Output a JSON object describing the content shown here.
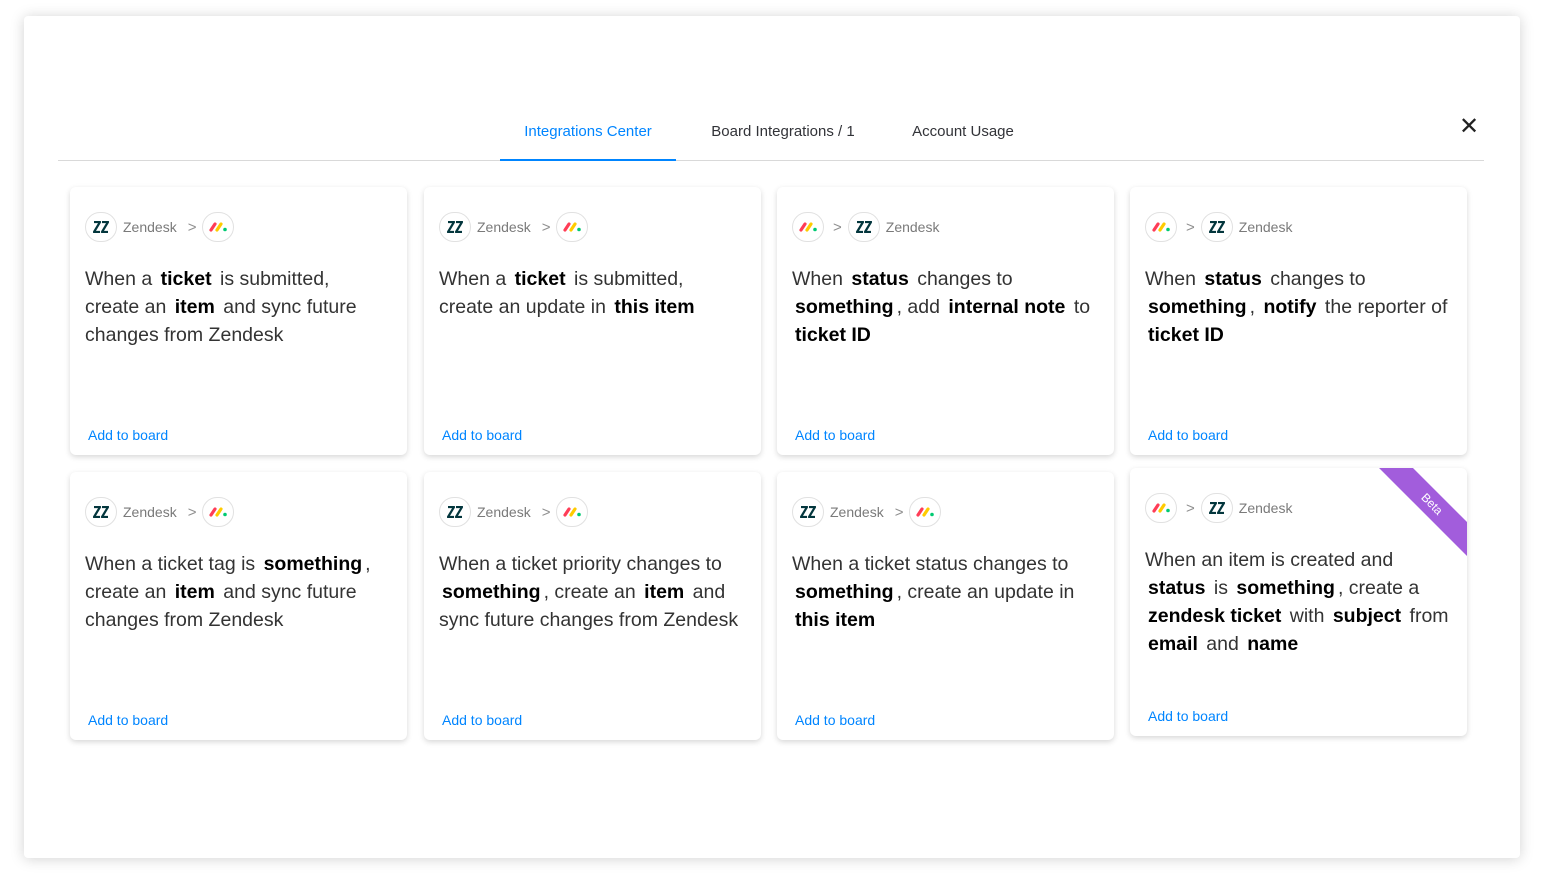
{
  "tabs": [
    {
      "label": "Integrations Center"
    },
    {
      "label": "Board Integrations / 1"
    },
    {
      "label": "Account Usage"
    }
  ],
  "close_glyph": "✕",
  "colors": {
    "accent": "#0085ff",
    "beta": "#a25ddc"
  },
  "cards": [
    {
      "from": "zendesk",
      "to": "monday",
      "label": "Zendesk",
      "text": [
        [
          "When a ",
          ""
        ],
        [
          "ticket",
          "b"
        ],
        [
          " is submitted, create an ",
          ""
        ],
        [
          "item",
          "b"
        ],
        [
          " and sync future changes from Zendesk",
          ""
        ]
      ],
      "action": "Add to board"
    },
    {
      "from": "zendesk",
      "to": "monday",
      "label": "Zendesk",
      "text": [
        [
          "When a ",
          ""
        ],
        [
          "ticket",
          "b"
        ],
        [
          " is submitted, create an update in ",
          ""
        ],
        [
          "this item",
          "b"
        ]
      ],
      "action": "Add to board"
    },
    {
      "from": "monday",
      "to": "zendesk",
      "label": "Zendesk",
      "text": [
        [
          "When ",
          ""
        ],
        [
          "status",
          "b"
        ],
        [
          " changes to ",
          ""
        ],
        [
          "something",
          "b"
        ],
        [
          ", add ",
          ""
        ],
        [
          "internal note",
          "b"
        ],
        [
          " to ",
          ""
        ],
        [
          "ticket ID",
          "b"
        ]
      ],
      "action": "Add to board"
    },
    {
      "from": "monday",
      "to": "zendesk",
      "label": "Zendesk",
      "text": [
        [
          "When ",
          ""
        ],
        [
          "status",
          "b"
        ],
        [
          " changes to ",
          ""
        ],
        [
          "something",
          "b"
        ],
        [
          ", ",
          ""
        ],
        [
          "notify",
          "b"
        ],
        [
          " the reporter of ",
          ""
        ],
        [
          "ticket ID",
          "b"
        ]
      ],
      "action": "Add to board"
    },
    {
      "from": "zendesk",
      "to": "monday",
      "label": "Zendesk",
      "text": [
        [
          "When a ticket tag is ",
          ""
        ],
        [
          "something",
          "b"
        ],
        [
          ", create an ",
          ""
        ],
        [
          "item",
          "b"
        ],
        [
          " and sync future changes from Zendesk",
          ""
        ]
      ],
      "action": "Add to board"
    },
    {
      "from": "zendesk",
      "to": "monday",
      "label": "Zendesk",
      "text": [
        [
          "When a ticket priority changes to ",
          ""
        ],
        [
          "something",
          "b"
        ],
        [
          ", create an ",
          ""
        ],
        [
          "item",
          "b"
        ],
        [
          " and sync future changes from Zendesk",
          ""
        ]
      ],
      "action": "Add to board"
    },
    {
      "from": "zendesk",
      "to": "monday",
      "label": "Zendesk",
      "text": [
        [
          "When a ticket status changes to ",
          ""
        ],
        [
          "something",
          "b"
        ],
        [
          ", create an update in ",
          ""
        ],
        [
          "this item",
          "b"
        ]
      ],
      "action": "Add to board"
    },
    {
      "from": "monday",
      "to": "zendesk",
      "label": "Zendesk",
      "text": [
        [
          "When an item is created and ",
          ""
        ],
        [
          "status",
          "b"
        ],
        [
          " is ",
          ""
        ],
        [
          "something",
          "b"
        ],
        [
          ", create a ",
          ""
        ],
        [
          "zendesk ticket",
          "b"
        ],
        [
          " with ",
          ""
        ],
        [
          "subject",
          "b"
        ],
        [
          " from ",
          ""
        ],
        [
          "email",
          "b"
        ],
        [
          " and ",
          ""
        ],
        [
          "name",
          "b"
        ]
      ],
      "action": "Add to board",
      "badge": "Beta"
    }
  ]
}
